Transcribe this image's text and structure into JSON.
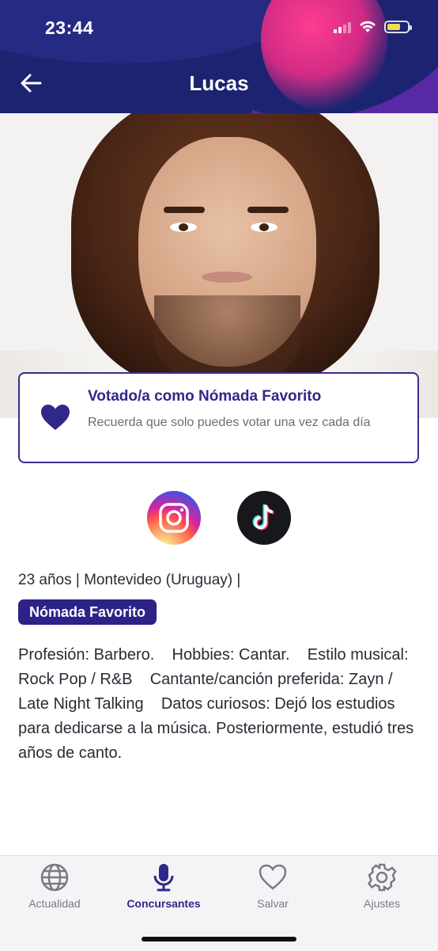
{
  "status_bar": {
    "time": "23:44"
  },
  "header": {
    "title": "Lucas",
    "back_icon": "arrow-left-icon"
  },
  "vote_card": {
    "title": "Votado/a como Nómada Favorito",
    "subtitle": "Recuerda que solo puedes votar una vez cada día",
    "icon": "heart-icon",
    "accent_color": "#2f2888"
  },
  "social": {
    "instagram_icon": "instagram-icon",
    "tiktok_icon": "tiktok-icon"
  },
  "profile": {
    "info_line": "23 años | Montevideo (Uruguay) |",
    "badge": "Nómada Favorito",
    "description": "Profesión: Barbero.    Hobbies: Cantar.    Estilo musical: Rock Pop / R&B    Cantante/canción preferida: Zayn / Late Night Talking    Datos curiosos: Dejó los estudios para dedicarse a la música. Posteriormente, estudió tres años de canto."
  },
  "tabbar": {
    "tabs": [
      {
        "label": "Actualidad",
        "icon": "globe-icon",
        "active": false
      },
      {
        "label": "Concursantes",
        "icon": "microphone-icon",
        "active": true
      },
      {
        "label": "Salvar",
        "icon": "heart-outline-icon",
        "active": false
      },
      {
        "label": "Ajustes",
        "icon": "gear-icon",
        "active": false
      }
    ]
  }
}
